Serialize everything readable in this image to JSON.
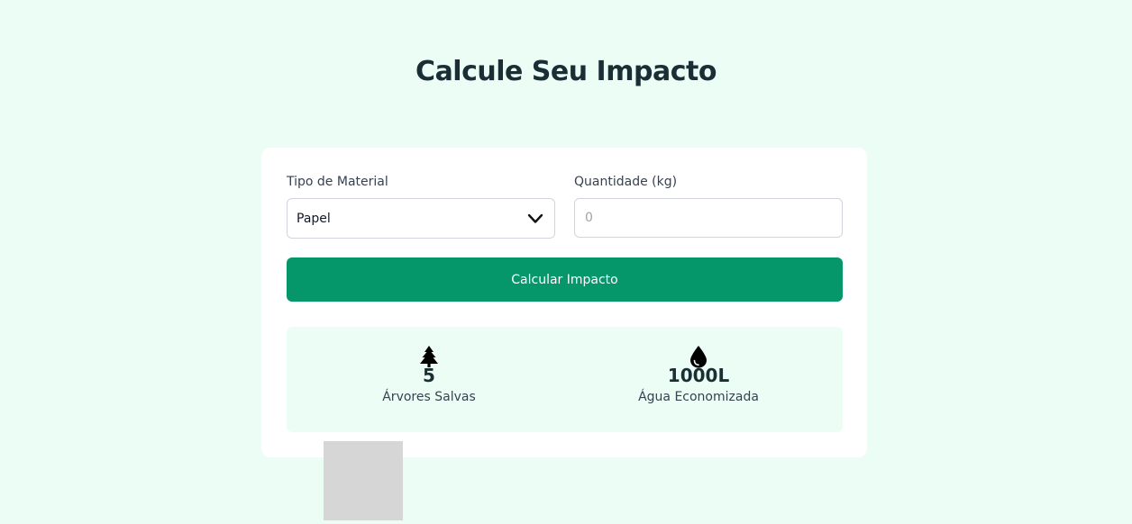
{
  "page": {
    "title": "Calcule Seu Impacto"
  },
  "form": {
    "material_label": "Tipo de Material",
    "material_value": "Papel",
    "material_icon": "chevron-down-icon",
    "quantity_label": "Quantidade (kg)",
    "quantity_placeholder": "0",
    "quantity_value": "",
    "submit_label": "Calcular Impacto"
  },
  "results": {
    "trees": {
      "icon": "tree-icon",
      "value": "5",
      "label": "Árvores Salvas"
    },
    "water": {
      "icon": "water-drop-icon",
      "value": "1000L",
      "label": "Água Economizada"
    }
  },
  "colors": {
    "page_background": "#ecfdf5",
    "accent": "#059669",
    "card_background": "#ffffff",
    "heading": "#1a2e35"
  }
}
